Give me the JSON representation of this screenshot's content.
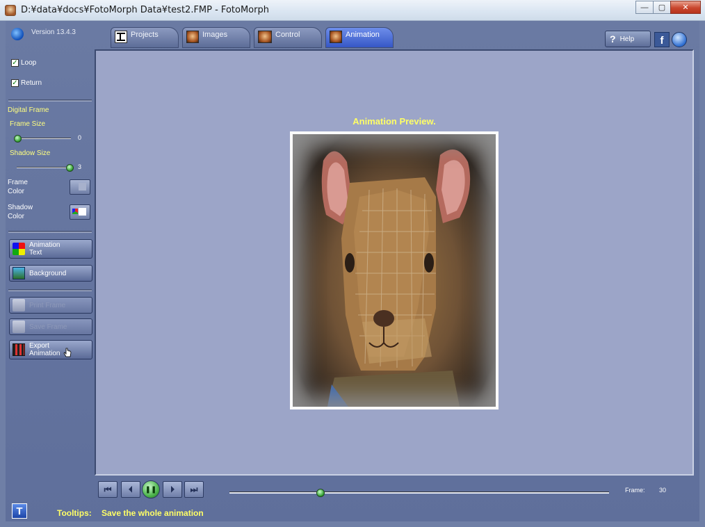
{
  "window": {
    "title": "D:¥data¥docs¥FotoMorph Data¥test2.FMP - FotoMorph",
    "minimize": "—",
    "maximize": "▢",
    "close": "✕"
  },
  "header": {
    "version": "Version 13.4.3",
    "tabs": [
      {
        "label": "Projects",
        "icon": "projects-icon",
        "active": false
      },
      {
        "label": "Images",
        "icon": "images-icon",
        "active": false
      },
      {
        "label": "Control",
        "icon": "control-icon",
        "active": false
      },
      {
        "label": "Animation",
        "icon": "animation-icon",
        "active": true
      }
    ],
    "help_label": "Help",
    "help_q": "?",
    "facebook_glyph": "f"
  },
  "sidebar": {
    "loop": {
      "label": "Loop",
      "checked": true
    },
    "return": {
      "label": "Return",
      "checked": true
    },
    "digital_frame": "Digital Frame",
    "frame_size": {
      "label": "Frame Size",
      "value": "0"
    },
    "shadow_size": {
      "label": "Shadow Size",
      "value": "3"
    },
    "frame_color_label": [
      "Frame",
      "Color"
    ],
    "shadow_color_label": [
      "Shadow",
      "Color"
    ],
    "buttons": [
      {
        "label": [
          "Animation",
          "Text"
        ],
        "icon": "abc-icon",
        "enabled": true
      },
      {
        "label": [
          "Background",
          ""
        ],
        "icon": "background-icon",
        "enabled": true
      },
      {
        "label": [
          "Print Frame",
          ""
        ],
        "icon": "print-icon",
        "enabled": false
      },
      {
        "label": [
          "Save Frame",
          ""
        ],
        "icon": "save-icon",
        "enabled": false
      },
      {
        "label": [
          "Export",
          "Animation"
        ],
        "icon": "film-icon",
        "enabled": true
      }
    ]
  },
  "preview": {
    "title": "Animation Preview."
  },
  "playback": {
    "first": "⏮",
    "prev": "⏴",
    "pause": "❚❚",
    "next": "⏵",
    "last": "⏭",
    "position": 0.24,
    "frame_label": "Frame:",
    "frame_value": "30"
  },
  "status": {
    "t_glyph": "T",
    "tooltips_label": "Tooltips:",
    "tooltips_text": "Save the whole animation"
  }
}
